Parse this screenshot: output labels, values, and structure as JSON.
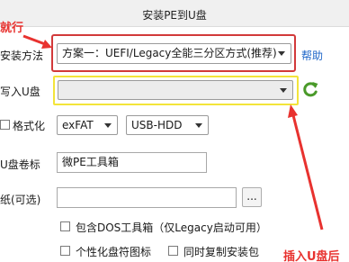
{
  "window": {
    "title": "安装PE到U盘"
  },
  "annotations": {
    "top_left_callout": "就行",
    "bottom_right_callout": "插入U盘后",
    "red_highlight_color": "#d2393a",
    "yellow_highlight_color": "#f3e43a",
    "arrow_color": "#e8322f"
  },
  "form": {
    "install_method": {
      "label": "安装方法",
      "value": "方案一：UEFI/Legacy全能三分区方式(推荐)",
      "help_link": "帮助"
    },
    "target_disk": {
      "label": "写入U盘",
      "value": "",
      "refresh_icon": "refresh-icon"
    },
    "format": {
      "label": "格式化",
      "checked": false,
      "filesystem": "exFAT",
      "mode": "USB-HDD"
    },
    "volume_label": {
      "label": "U盘卷标",
      "value": "微PE工具箱"
    },
    "wallpaper": {
      "label": "纸(可选)",
      "value": "",
      "browse_label": "..."
    },
    "options": {
      "include_dos": "包含DOS工具箱（仅Legacy启动可用）",
      "personalize_icon": "个性化盘符图标",
      "copy_installer": "同时复制安装包"
    }
  }
}
